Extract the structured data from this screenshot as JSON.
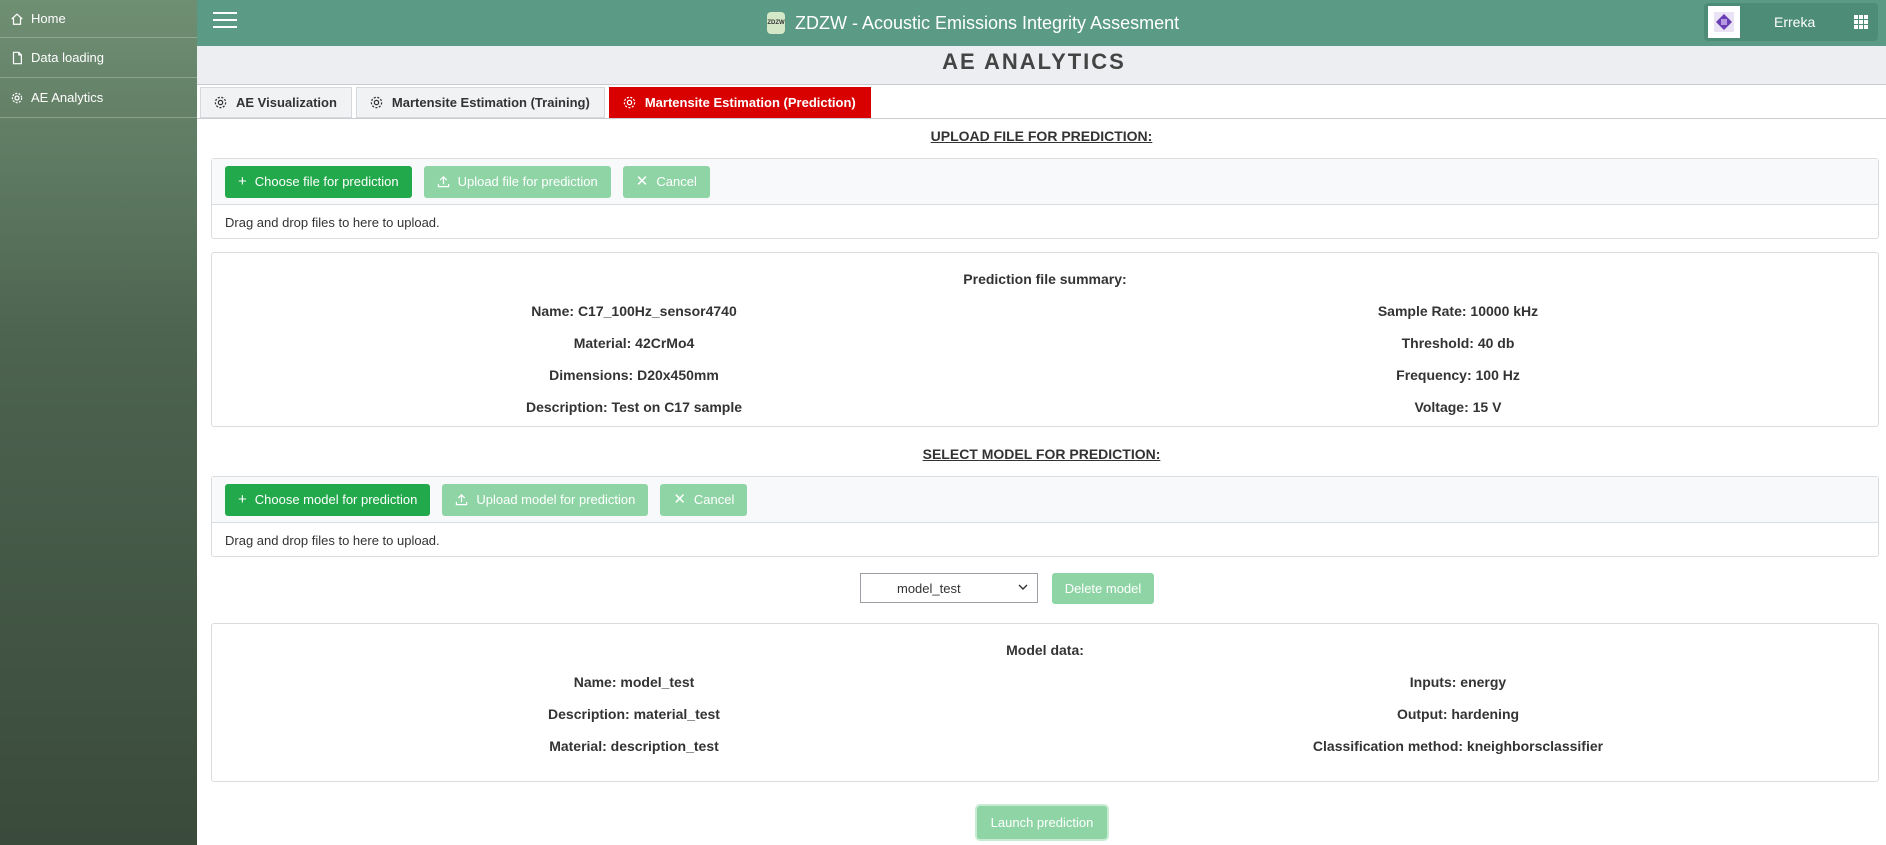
{
  "sidebar": {
    "items": [
      {
        "label": "Home",
        "icon": "home-icon"
      },
      {
        "label": "Data loading",
        "icon": "file-icon"
      },
      {
        "label": "AE Analytics",
        "icon": "gear-icon"
      }
    ]
  },
  "header": {
    "title": "ZDZW - Acoustic Emissions Integrity Assesment",
    "logo_text": "ZDZW",
    "user_name": "Erreka"
  },
  "section_title": "AE ANALYTICS",
  "tabs": [
    {
      "label": "AE Visualization",
      "active": false
    },
    {
      "label": "Martensite Estimation (Training)",
      "active": false
    },
    {
      "label": "Martensite Estimation (Prediction)",
      "active": true
    }
  ],
  "upload_file": {
    "heading": "UPLOAD FILE FOR PREDICTION:",
    "choose_label": "Choose file for prediction",
    "upload_label": "Upload file for prediction",
    "cancel_label": "Cancel",
    "drop_text": "Drag and drop files to here to upload."
  },
  "file_summary": {
    "title": "Prediction file summary:",
    "left": [
      "Name: C17_100Hz_sensor4740",
      "Material: 42CrMo4",
      "Dimensions: D20x450mm",
      "Description: Test on C17 sample"
    ],
    "right": [
      "Sample Rate: 10000 kHz",
      "Threshold: 40 db",
      "Frequency: 100 Hz",
      "Voltage: 15 V"
    ]
  },
  "select_model": {
    "heading": "SELECT MODEL FOR PREDICTION:",
    "choose_label": "Choose model for prediction",
    "upload_label": "Upload model for prediction",
    "cancel_label": "Cancel",
    "drop_text": "Drag and drop files to here to upload.",
    "selected": "model_test",
    "delete_label": "Delete model"
  },
  "model_data": {
    "title": "Model data:",
    "left": [
      "Name: model_test",
      "Description: material_test",
      "Material: description_test"
    ],
    "right": [
      "Inputs: energy",
      "Output: hardening",
      "Classification method: kneighborsclassifier"
    ]
  },
  "launch_label": "Launch prediction",
  "colors": {
    "header": "#5b9b86",
    "active_tab": "#d90000",
    "primary_button": "#22a94b",
    "disabled_button": "#8fd4a5"
  }
}
